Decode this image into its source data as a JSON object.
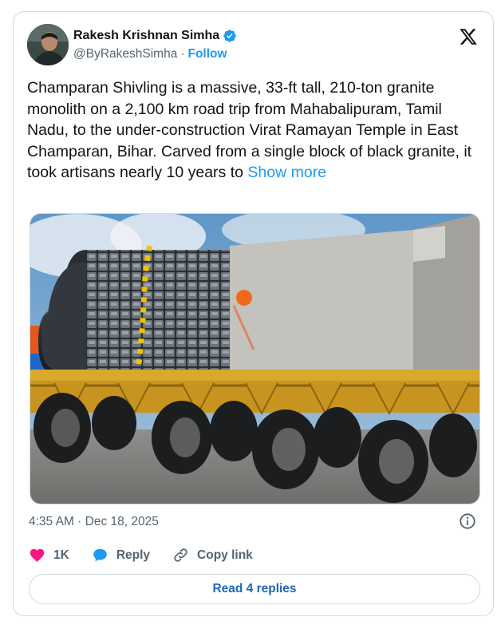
{
  "author": {
    "name": "Rakesh Krishnan Simha",
    "handle": "@ByRakeshSimha",
    "separator": "·",
    "follow_label": "Follow"
  },
  "tweet": {
    "text": "Champaran Shivling is a massive, 33-ft tall, 210-ton granite monolith on a 2,100 km road trip from Mahabalipuram, Tamil Nadu, to the under-construction Virat Ramayan Temple in East Champaran, Bihar. Carved from a single block of black granite, it took artisans nearly 10 years to",
    "show_more_label": "Show more",
    "timestamp": "4:35 AM · Dec 18, 2025"
  },
  "actions": {
    "like_count": "1K",
    "reply_label": "Reply",
    "copy_link_label": "Copy link"
  },
  "footer": {
    "read_replies_label": "Read 4 replies"
  },
  "icons": {
    "verified": "verified-badge-icon",
    "logo": "x-logo-icon",
    "info": "info-icon",
    "like": "heart-icon",
    "reply": "chat-bubble-icon",
    "copy_link": "link-icon"
  },
  "colors": {
    "accent": "#1d9bf0",
    "like": "#f91880",
    "secondary_text": "#536471",
    "border": "#cfd9de",
    "read_replies_text": "#1d67b8"
  }
}
